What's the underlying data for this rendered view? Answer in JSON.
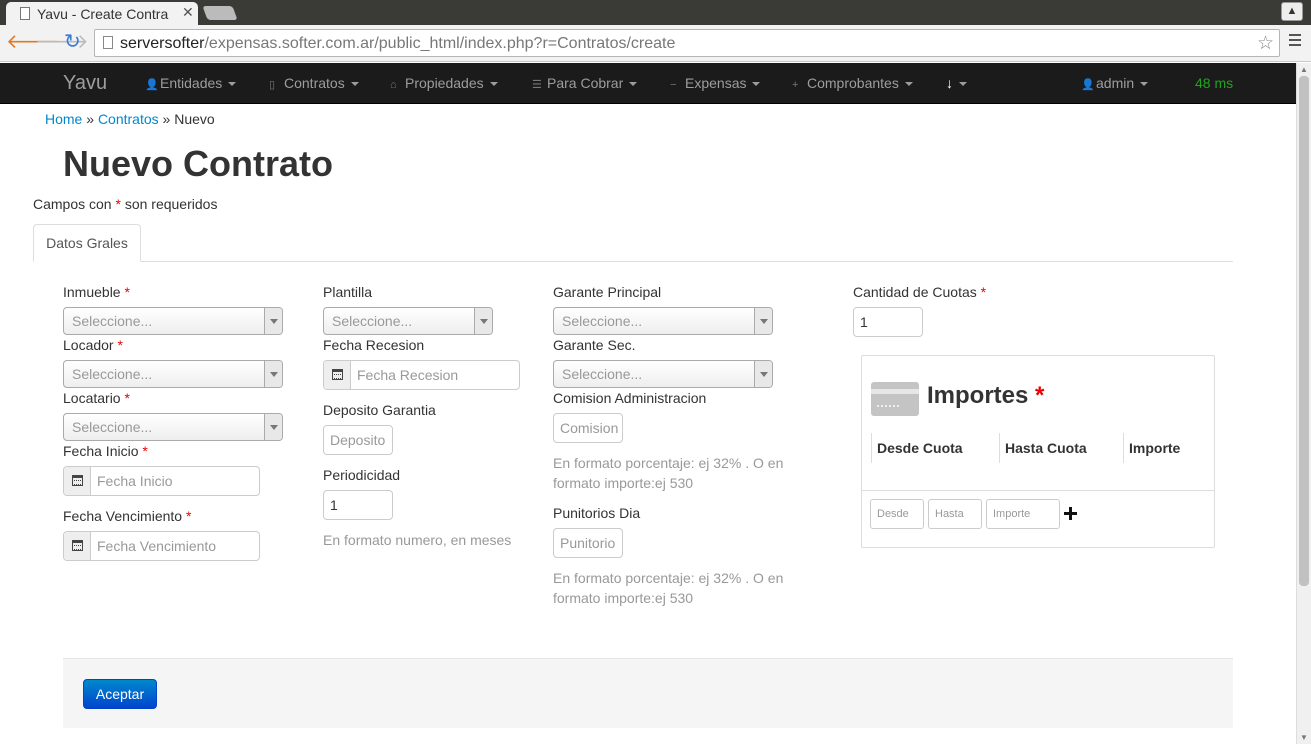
{
  "browser": {
    "tab_title": "Yavu - Create Contra",
    "tab_close": "✕",
    "url_host": "serversofter",
    "url_path": "/expensas.softer.com.ar/public_html/index.php?r=Contratos/create"
  },
  "navbar": {
    "brand": "Yavu",
    "items": [
      {
        "label": "Entidades",
        "icon": "user-icon"
      },
      {
        "label": "Contratos",
        "icon": "file-icon"
      },
      {
        "label": "Propiedades",
        "icon": "home-icon"
      },
      {
        "label": "Para Cobrar",
        "icon": "list-icon"
      },
      {
        "label": "Expensas",
        "icon": "minus-icon"
      },
      {
        "label": "Comprobantes",
        "icon": "plus-icon"
      },
      {
        "label": "",
        "icon": "download-icon"
      }
    ],
    "user": "admin",
    "timer": "48 ms"
  },
  "breadcrumb": {
    "home": "Home",
    "sep": "»",
    "contratos": "Contratos",
    "current": "Nuevo"
  },
  "page": {
    "title": "Nuevo Contrato",
    "required_prefix": "Campos con ",
    "required_star": "*",
    "required_suffix": " son requeridos",
    "tab": "Datos Grales"
  },
  "form": {
    "inmueble": {
      "label": "Inmueble",
      "value": "Seleccione..."
    },
    "locador": {
      "label": "Locador",
      "value": "Seleccione..."
    },
    "locatario": {
      "label": "Locatario",
      "value": "Seleccione..."
    },
    "fecha_inicio": {
      "label": "Fecha Inicio",
      "placeholder": "Fecha Inicio"
    },
    "fecha_vencimiento": {
      "label": "Fecha Vencimiento",
      "placeholder": "Fecha Vencimiento"
    },
    "plantilla": {
      "label": "Plantilla",
      "value": "Seleccione..."
    },
    "fecha_recesion": {
      "label": "Fecha Recesion",
      "placeholder": "Fecha Recesion"
    },
    "deposito_garantia": {
      "label": "Deposito Garantia",
      "placeholder": "Deposito"
    },
    "periodicidad": {
      "label": "Periodicidad",
      "value": "1",
      "help": "En formato numero, en meses"
    },
    "garante_principal": {
      "label": "Garante Principal",
      "value": "Seleccione..."
    },
    "garante_sec": {
      "label": "Garante Sec.",
      "value": "Seleccione..."
    },
    "comision": {
      "label": "Comision Administracion",
      "placeholder": "Comision",
      "help_1": "En formato porcentaje: ej 32% . O en",
      "help_2": "formato importe:ej 530"
    },
    "punitorios": {
      "label": "Punitorios Dia",
      "placeholder": "Punitorio",
      "help_1": "En formato porcentaje: ej 32% . O en",
      "help_2": "formato importe:ej 530"
    },
    "cantidad_cuotas": {
      "label": "Cantidad de Cuotas",
      "value": "1"
    },
    "required_mark": "*"
  },
  "importes": {
    "title": "Importes",
    "star": "*",
    "columns": [
      "Desde Cuota",
      "Hasta Cuota",
      "Importe"
    ],
    "inputs": [
      "Desde",
      "Hasta",
      "Importe"
    ]
  },
  "actions": {
    "submit": "Aceptar"
  }
}
